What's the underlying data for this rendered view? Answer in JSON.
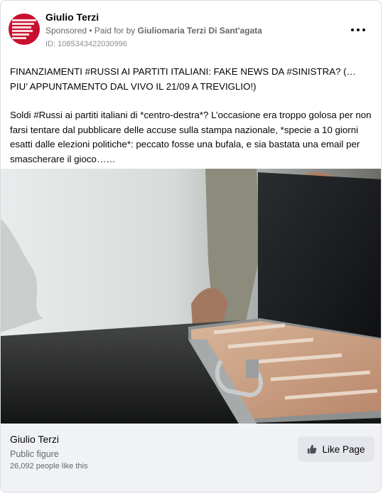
{
  "ad": {
    "page_name": "Giulio Terzi",
    "sponsored_label": "Sponsored",
    "paid_for_prefix": " • Paid for by ",
    "payer": "Giuliomaria Terzi Di Sant'agata",
    "ad_id": "ID: 1085343422030996",
    "more_icon": "more-horizontal-icon",
    "avatar_icon": "page-avatar-logo"
  },
  "post": {
    "paragraphs": [
      "FINANZIAMENTI #RUSSI AI PARTITI ITALIANI: FAKE NEWS DA #SINISTRA? (… PIU’ APPUNTAMENTO DAL VIVO IL 21/09 A TREVIGLIO!)",
      "Soldi #Russi ai partiti italiani di *centro-destra*? L’occasione era troppo golosa per non farsi tentare dal pubblicare delle accuse sulla stampa nazionale, *specie a 10 giorni esatti dalle elezioni politiche*: peccato fosse una bufala, e sia bastata una email per smascherare il gioco……"
    ]
  },
  "footer": {
    "page_name": "Giulio Terzi",
    "category": "Public figure",
    "likes": "26,092 people like this",
    "like_button_label": "Like Page",
    "like_icon": "thumbs-up-icon"
  },
  "colors": {
    "avatar_red": "#c8102e",
    "footer_bg": "#f0f2f5",
    "button_bg": "#e4e6eb"
  }
}
